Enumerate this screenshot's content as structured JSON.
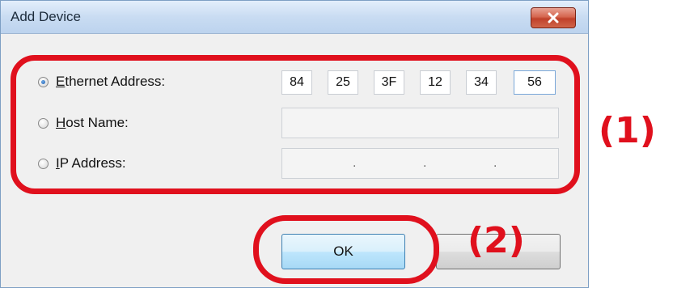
{
  "window": {
    "title": "Add Device",
    "close_icon": "close-icon"
  },
  "rows": {
    "ethernet": {
      "label_prefix": "",
      "mnemonic": "E",
      "label_rest": "thernet Address:",
      "selected": true
    },
    "hostname": {
      "mnemonic": "H",
      "label_rest": "ost Name:",
      "selected": false
    },
    "ip": {
      "mnemonic": "I",
      "label_rest": "P Address:",
      "selected": false
    }
  },
  "ethernet_octets": [
    "84",
    "25",
    "3F",
    "12",
    "34",
    "56"
  ],
  "ip_separators": [
    ".",
    ".",
    "."
  ],
  "buttons": {
    "ok_label": "OK"
  },
  "annotations": {
    "label_1": "(1)",
    "label_2": "(2)",
    "color": "#e0101d"
  }
}
